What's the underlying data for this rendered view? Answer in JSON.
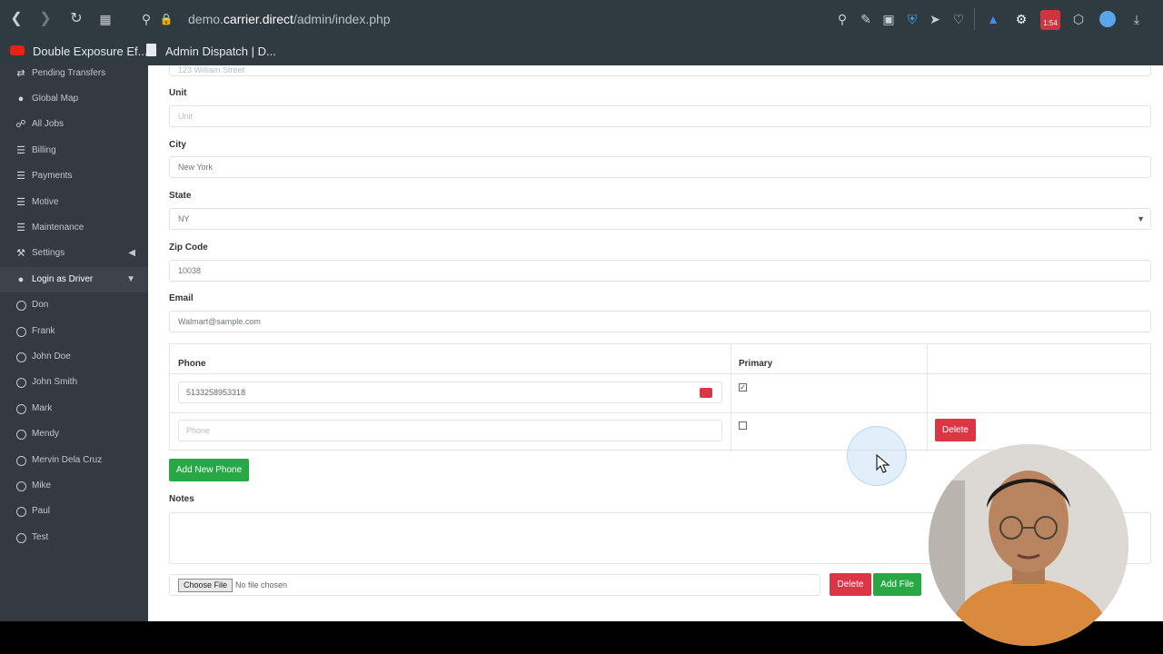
{
  "browser": {
    "url_prefix": "demo.",
    "url_domain": "carrier.direct",
    "url_path": "/admin/index.php",
    "timer_badge": "1:54",
    "bookmarks": [
      {
        "label": "Double Exposure Ef..."
      },
      {
        "label": "Admin Dispatch | D..."
      }
    ]
  },
  "sidebar": {
    "items": [
      {
        "label": "Pending Transfers",
        "icon": "transfer-icon"
      },
      {
        "label": "Global Map",
        "icon": "map-pin-icon"
      },
      {
        "label": "All Jobs",
        "icon": "cart-icon"
      },
      {
        "label": "Billing",
        "icon": "list-icon"
      },
      {
        "label": "Payments",
        "icon": "list-icon"
      },
      {
        "label": "Motive",
        "icon": "list-icon"
      },
      {
        "label": "Maintenance",
        "icon": "list-icon"
      },
      {
        "label": "Settings",
        "icon": "wrench-icon"
      },
      {
        "label": "Login as Driver",
        "icon": "user-icon"
      }
    ],
    "drivers": [
      "Don",
      "Frank",
      "John Doe",
      "John Smith",
      "Mark",
      "Mendy",
      "Mervin Dela Cruz",
      "Mike",
      "Paul",
      "Test"
    ]
  },
  "form": {
    "address_partial": "123 William Street",
    "unit_label": "Unit",
    "unit_placeholder": "Unit",
    "city_label": "City",
    "city_value": "New York",
    "state_label": "State",
    "state_value": "NY",
    "zip_label": "Zip Code",
    "zip_value": "10038",
    "email_label": "Email",
    "email_value": "Walmart@sample.com",
    "phone_header": "Phone",
    "primary_header": "Primary",
    "phones": [
      {
        "value": "5133258953318",
        "primary": true
      },
      {
        "placeholder": "Phone",
        "primary": false,
        "delete_label": "Delete"
      }
    ],
    "add_phone_label": "Add New Phone",
    "notes_label": "Notes",
    "choose_file_label": "Choose File",
    "no_file_label": "No file chosen",
    "file_delete_label": "Delete",
    "add_file_label": "Add File"
  }
}
